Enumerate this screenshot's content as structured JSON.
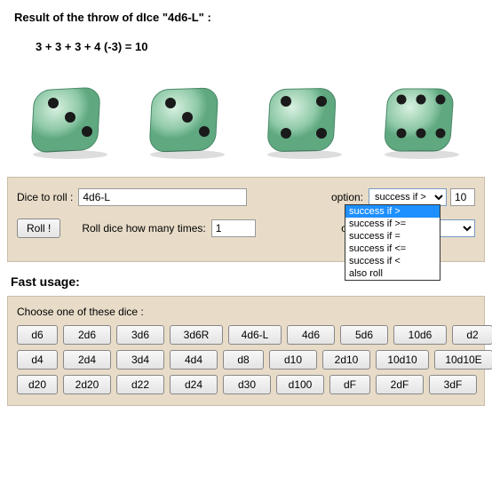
{
  "result": {
    "title": "Result of the throw of dIce \"4d6-L\"  :",
    "calc": "3 + 3 + 3 + 4 (-3) = 10",
    "dice_faces": [
      3,
      3,
      4,
      6
    ]
  },
  "controls": {
    "dice_label": "Dice to roll :",
    "dice_value": "4d6-L",
    "option_label": "option:",
    "option_selected": "success if >",
    "option_value": "10",
    "roll_label": "Roll !",
    "times_label": "Roll dice how many times:",
    "times_value": "1",
    "option2_label": "option",
    "option2_selected": "",
    "dropdown_items": [
      "success if >",
      "success if >=",
      "success if =",
      "success if <=",
      "success if <",
      "also roll"
    ]
  },
  "fast": {
    "title": "Fast usage:",
    "choose": "Choose one of these dice :",
    "row1": [
      "d6",
      "2d6",
      "3d6",
      "3d6R",
      "4d6-L",
      "4d6",
      "5d6",
      "10d6",
      "d2"
    ],
    "row2": [
      "d4",
      "2d4",
      "3d4",
      "4d4",
      "d8",
      "d10",
      "2d10",
      "10d10",
      "10d10E"
    ],
    "row3": [
      "d20",
      "2d20",
      "d22",
      "d24",
      "d30",
      "d100",
      "dF",
      "2dF",
      "3dF"
    ]
  }
}
